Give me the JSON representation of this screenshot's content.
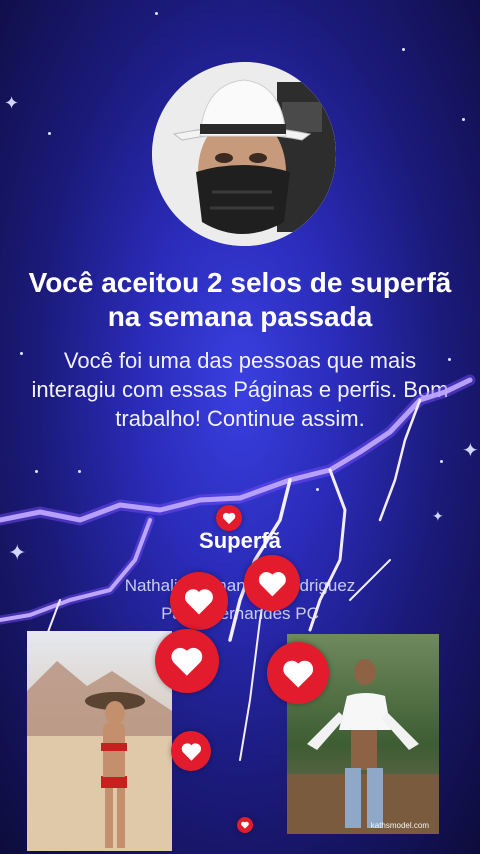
{
  "page": {
    "heading": "Você aceitou 2 selos de superfã na semana passada",
    "description": "Você foi uma das pessoas que mais interagiu com essas Páginas e perfis. Bom trabalho! Continue assim.",
    "badge_label": "Superfã",
    "names_line1": "Nathalia Fernandes Rodriguez",
    "names_line2": "Paula Fernandes PC",
    "photo_watermark": "kathsmodel.com"
  },
  "colors": {
    "background": "#2a2bb8",
    "heart_red": "#e21c2c",
    "text": "#ffffff"
  },
  "icons": {
    "heart": "heart-icon",
    "sparkle": "sparkle-icon",
    "lightning": "lightning-decoration"
  }
}
